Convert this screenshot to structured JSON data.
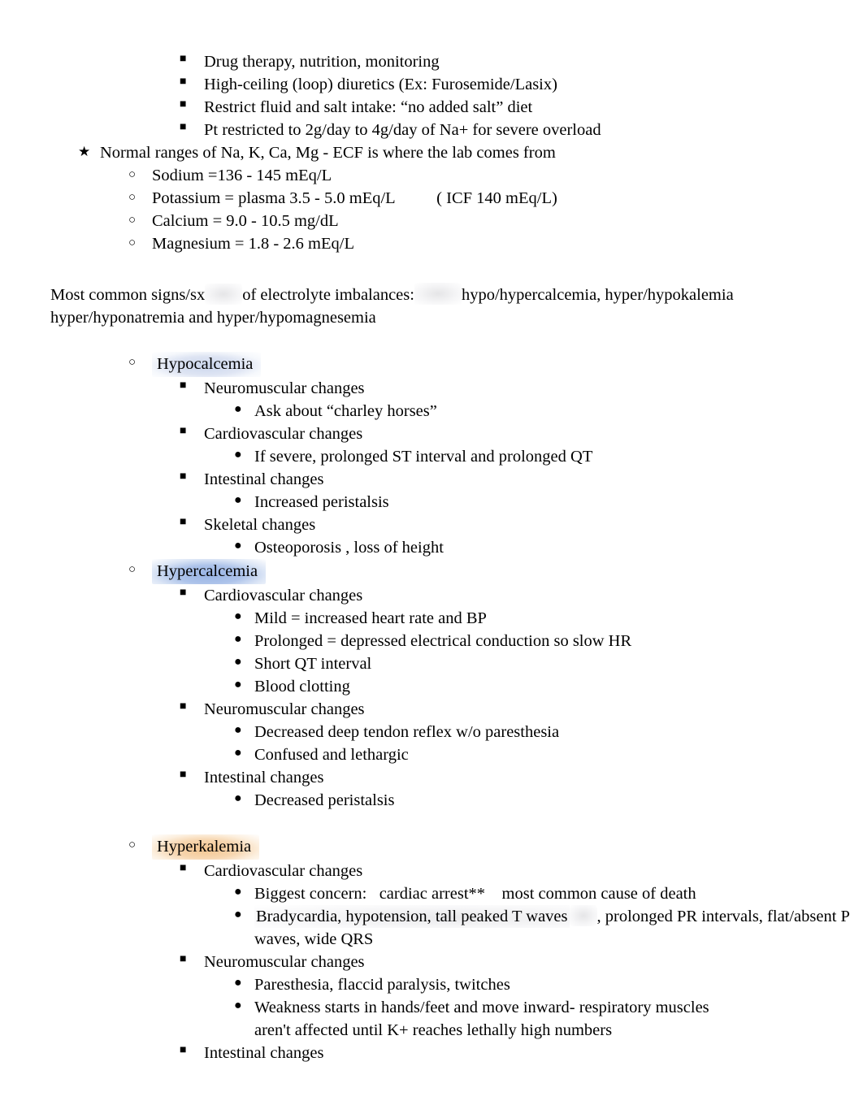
{
  "document": {
    "title": "Electrolyte Imbalances Study Notes",
    "page_background": "#ffffff",
    "text_color": "#000000"
  },
  "bullets": {
    "square": "■",
    "circle": "○",
    "dot": "●",
    "star": "★"
  },
  "highlight_colors": {
    "hypocalcemia": "#c8d4ec",
    "hypercalcemia": "#96b2e4",
    "hyperkalemia": "#f3c48d",
    "smudge_gray": "#e4e4e6"
  },
  "top_list": {
    "items": [
      "Drug therapy, nutrition, monitoring",
      "High-ceiling (loop) diuretics (Ex: Furosemide/Lasix)",
      "Restrict fluid and salt intake: “no added salt” diet",
      "Pt restricted to 2g/day to 4g/day of Na+ for severe overload"
    ]
  },
  "normal_ranges": {
    "heading": "Normal ranges of Na, K, Ca, Mg - ECF is where the lab comes from",
    "items": [
      "Sodium =136 - 145 mEq/L",
      "Potassium = plasma 3.5 - 5.0 mEq/L          ( ICF 140 mEq/L)",
      "Calcium = 9.0 - 10.5 mg/dL",
      "Magnesium = 1.8 - 2.6 mEq/L"
    ]
  },
  "intro_paragraph": {
    "segment_1": "Most common signs/sx",
    "segment_2": "of electrolyte imbalances:",
    "segment_3": "hypo/hypercalcemia, hyper/hypokalemia",
    "line_2": "hyper/hyponatremia and hyper/hypomagnesemia"
  },
  "sections": [
    {
      "title": "Hypocalcemia",
      "highlight": "hypocalcemia",
      "groups": [
        {
          "heading": "Neuromuscular changes",
          "details": [
            "Ask about “charley horses”"
          ]
        },
        {
          "heading": "Cardiovascular changes",
          "details": [
            "If severe, prolonged ST interval and prolonged QT"
          ]
        },
        {
          "heading": "Intestinal changes",
          "details": [
            "Increased peristalsis"
          ]
        },
        {
          "heading": "Skeletal changes",
          "details": [
            "Osteoporosis , loss of height"
          ]
        }
      ]
    },
    {
      "title": "Hypercalcemia",
      "highlight": "hypercalcemia",
      "groups": [
        {
          "heading": "Cardiovascular changes",
          "details": [
            "Mild = increased heart rate and BP",
            "Prolonged = depressed electrical conduction so slow HR",
            "Short QT interval",
            "Blood clotting"
          ]
        },
        {
          "heading": "Neuromuscular changes",
          "details": [
            "Decreased deep tendon reflex w/o paresthesia",
            "Confused and lethargic"
          ]
        },
        {
          "heading": "Intestinal changes",
          "details": [
            "Decreased peristalsis"
          ]
        }
      ]
    },
    {
      "title": "Hyperkalemia",
      "highlight": "hyperkalemia",
      "groups": [
        {
          "heading": "Cardiovascular changes",
          "details": [
            "Biggest concern:   cardiac arrest**    most common cause of death",
            "Bradycardia, hypotension, tall peaked T waves",
            ", prolonged PR intervals, flat/absent P waves, wide QRS"
          ]
        },
        {
          "heading": "Neuromuscular changes",
          "details": [
            "Paresthesia, flaccid paralysis, twitches",
            "Weakness starts in hands/feet and move inward- respiratory muscles aren't affected until K+ reaches lethally high numbers"
          ]
        },
        {
          "heading": "Intestinal changes",
          "details": []
        }
      ]
    }
  ]
}
